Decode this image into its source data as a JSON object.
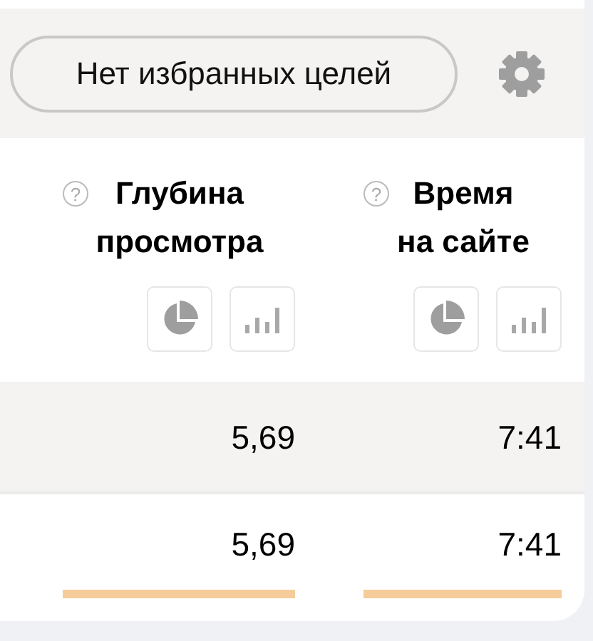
{
  "toolbar": {
    "goals_button": "Нет избранных целей"
  },
  "columns": [
    {
      "help": "?",
      "title": "Глубина просмотра",
      "views": [
        {
          "kind": "pie"
        },
        {
          "kind": "bar"
        }
      ]
    },
    {
      "help": "?",
      "title": "Время на сайте",
      "views": [
        {
          "kind": "pie"
        },
        {
          "kind": "bar"
        }
      ]
    }
  ],
  "rows": [
    {
      "kind": "total",
      "cells": [
        {
          "value": "5,69"
        },
        {
          "value": "7:41"
        }
      ]
    },
    {
      "kind": "data",
      "cells": [
        {
          "value": "5,69"
        },
        {
          "value": "7:41"
        }
      ]
    }
  ]
}
